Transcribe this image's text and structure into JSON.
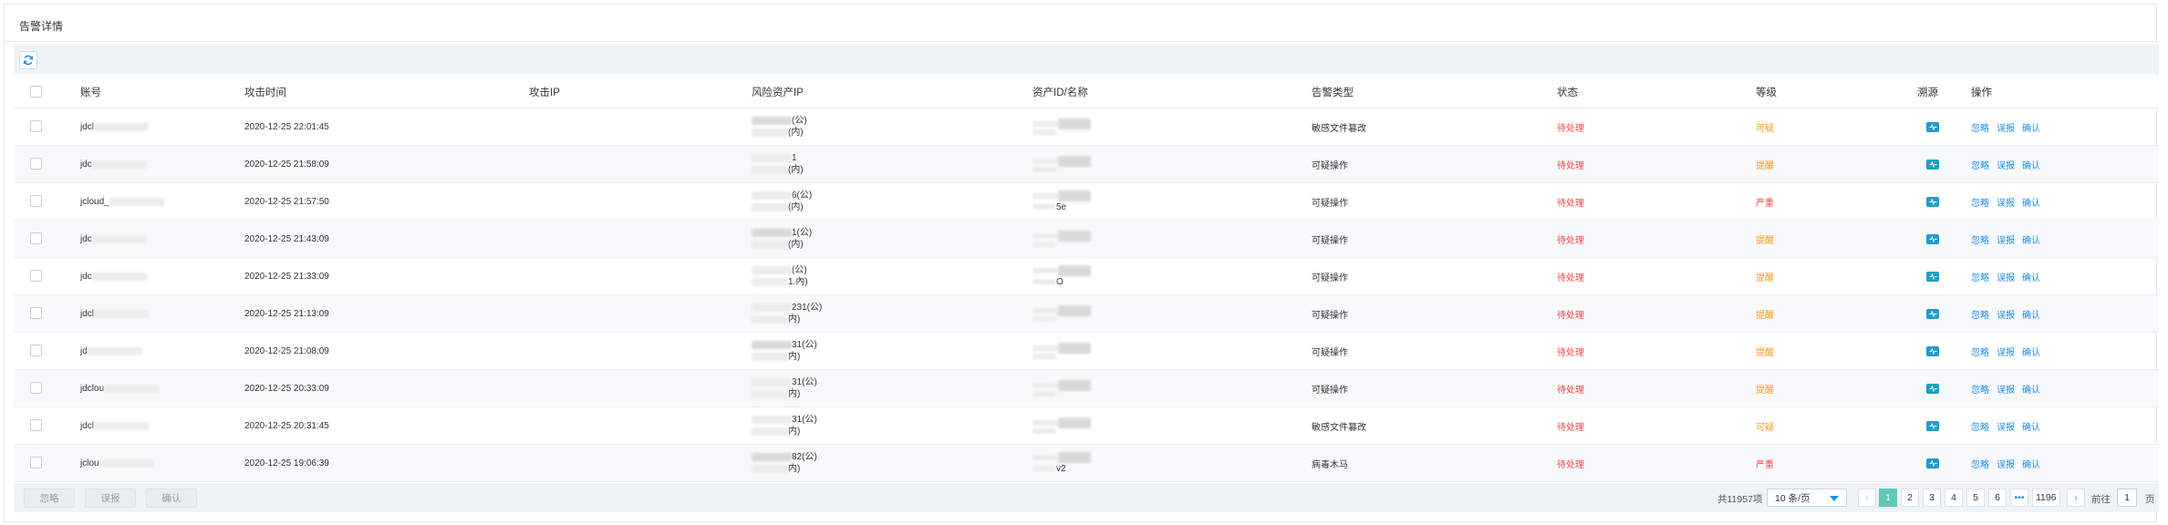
{
  "panel": {
    "title": "告警详情"
  },
  "toolbar": {
    "refresh_icon": "refresh-icon"
  },
  "table": {
    "headers": [
      "账号",
      "攻击时间",
      "攻击IP",
      "风险资产IP",
      "资产ID/名称",
      "告警类型",
      "状态",
      "等级",
      "溯源",
      "操作"
    ],
    "rows": [
      {
        "account": "jdcl",
        "time": "2020-12-25 22:01:45",
        "attack_ip": "",
        "ip_pub": "(公)",
        "ip_priv": "(内)",
        "asset": "",
        "alert_type": "敏感文件篡改",
        "status": "待处理",
        "level": "可疑",
        "level_color": "#f59a23"
      },
      {
        "account": "jdc",
        "time": "2020-12-25 21:58:09",
        "attack_ip": "",
        "ip_pub": "1",
        "ip_priv": "(内)",
        "asset": "",
        "alert_type": "可疑操作",
        "status": "待处理",
        "level": "提醒",
        "level_color": "#f59a23"
      },
      {
        "account": "jcloud_",
        "time": "2020-12-25 21:57:50",
        "attack_ip": "",
        "ip_pub": "6(公)",
        "ip_priv": "(内)",
        "asset": "5e",
        "alert_type": "可疑操作",
        "status": "待处理",
        "level": "严重",
        "level_color": "#f0474b"
      },
      {
        "account": "jdc",
        "time": "2020-12-25 21:43:09",
        "attack_ip": "",
        "ip_pub": "1(公)",
        "ip_priv": "(内)",
        "asset": "",
        "alert_type": "可疑操作",
        "status": "待处理",
        "level": "提醒",
        "level_color": "#f59a23"
      },
      {
        "account": "jdc",
        "time": "2020-12-25 21:33:09",
        "attack_ip": "",
        "ip_pub": "(公)",
        "ip_priv": "1.內)",
        "asset": "O",
        "alert_type": "可疑操作",
        "status": "待处理",
        "level": "提醒",
        "level_color": "#f59a23"
      },
      {
        "account": "jdcl",
        "time": "2020-12-25 21:13:09",
        "attack_ip": "",
        "ip_pub": "231(公)",
        "ip_priv": "内)",
        "asset": "",
        "alert_type": "可疑操作",
        "status": "待处理",
        "level": "提醒",
        "level_color": "#f59a23"
      },
      {
        "account": "jd",
        "time": "2020-12-25 21:08:09",
        "attack_ip": "",
        "ip_pub": "31(公)",
        "ip_priv": "内)",
        "asset": "",
        "alert_type": "可疑操作",
        "status": "待处理",
        "level": "提醒",
        "level_color": "#f59a23"
      },
      {
        "account": "jdclou",
        "time": "2020-12-25 20:33:09",
        "attack_ip": "",
        "ip_pub": "31(公)",
        "ip_priv": "内)",
        "asset": "",
        "alert_type": "可疑操作",
        "status": "待处理",
        "level": "提醒",
        "level_color": "#f59a23"
      },
      {
        "account": "jdcl",
        "time": "2020-12-25 20:31:45",
        "attack_ip": "",
        "ip_pub": "31(公)",
        "ip_priv": "内)",
        "asset": "",
        "alert_type": "敏感文件篡改",
        "status": "待处理",
        "level": "可疑",
        "level_color": "#f59a23"
      },
      {
        "account": "jclou",
        "time": "2020-12-25 19:06:39",
        "attack_ip": "",
        "ip_pub": "82(公)",
        "ip_priv": "内)",
        "asset": "v2",
        "alert_type": "病毒木马",
        "status": "待处理",
        "level": "严重",
        "level_color": "#f0474b"
      }
    ],
    "ops": [
      "忽略",
      "误报",
      "确认"
    ],
    "trace_icon": "trace-icon"
  },
  "footer": {
    "buttons": [
      "忽略",
      "误报",
      "确认"
    ],
    "total": "共11957项",
    "page_size": "10 条/页",
    "pages": [
      "1",
      "2",
      "3",
      "4",
      "5",
      "6",
      "•••",
      "1196"
    ],
    "current_page": "1",
    "goto_label": "前往",
    "goto_value": "1",
    "goto_suffix": "页"
  }
}
